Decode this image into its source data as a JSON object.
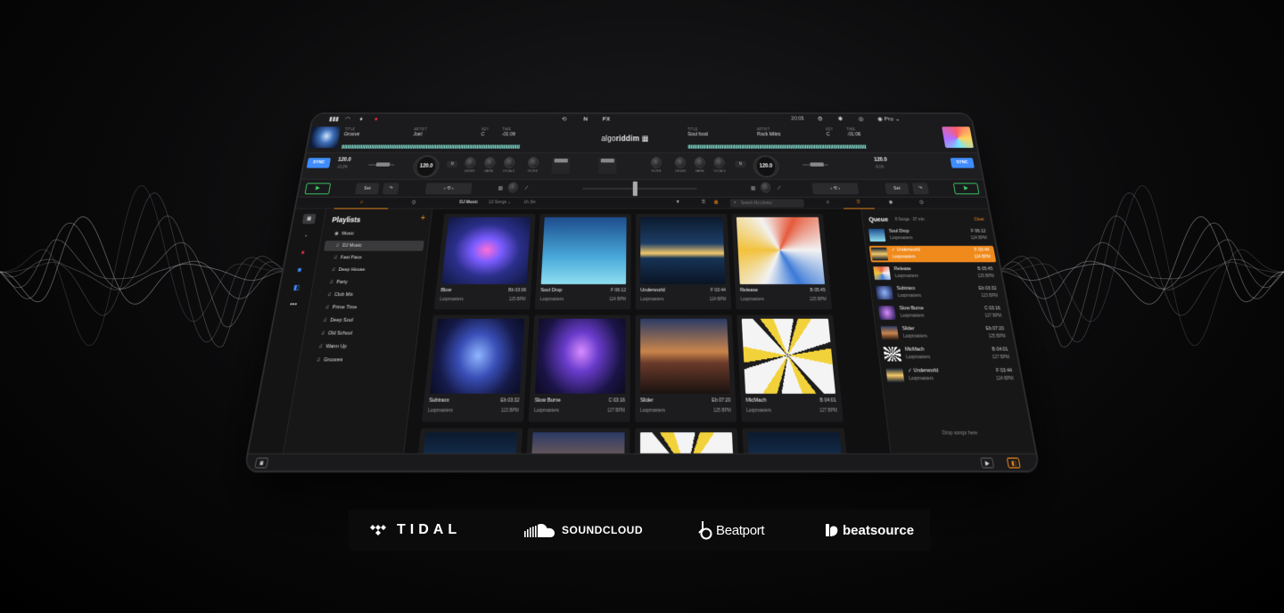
{
  "colors": {
    "accent": "#f08a1c",
    "sync": "#3f8cff",
    "play": "#3ed66a",
    "record": "#e0343a"
  },
  "toolbar": {
    "left_icons": [
      "eq-icon",
      "headphones-icon",
      "mic-icon",
      "record-icon"
    ],
    "center_icons": [
      "loop-icon",
      "n-icon",
      "fx-icon"
    ],
    "center_labels": {
      "n": "N",
      "fx": "FX"
    },
    "clock": "20:05",
    "pro_label": "Pro"
  },
  "deck_left": {
    "title_label": "TITLE",
    "title": "Groove",
    "artist_label": "ARTIST",
    "artist": "Joel",
    "key_label": "KEY",
    "key": "C",
    "time_label": "TIME",
    "time": "-01:09",
    "sync": "SYNC",
    "bpm": "120.0",
    "bpm_sub": "-13.2%",
    "jog_bpm": "120.0",
    "knobs": [
      "DRUMS",
      "HARM.",
      "VOCALS",
      "FILTER"
    ],
    "play": "▶",
    "set": "Set"
  },
  "deck_right": {
    "title_label": "TITLE",
    "title": "Soul food",
    "artist_label": "ARTIST",
    "artist": "Rock Miles",
    "key_label": "KEY",
    "key": "C",
    "time_label": "TIME",
    "time": "-01:06",
    "sync": "SYNC",
    "bpm": "120.0",
    "bpm_sub": "-9.1%",
    "jog_bpm": "120.0",
    "knobs": [
      "FILTER",
      "DRUMS",
      "HARM.",
      "VOCALS"
    ],
    "play": "▶",
    "set": "Set"
  },
  "logo": {
    "brand_light": "algo",
    "brand_bold": "riddim"
  },
  "browse": {
    "section": "DJ Music",
    "song_count": "13 Songs",
    "duration": "1h 3m",
    "search_placeholder": "Search My Library"
  },
  "sidebar": {
    "title": "Playlists",
    "add": "+",
    "items": [
      {
        "label": "Music"
      },
      {
        "label": "DJ Music"
      },
      {
        "label": "Fast Pace"
      },
      {
        "label": "Deep House"
      },
      {
        "label": "Party"
      },
      {
        "label": "Club Mix"
      },
      {
        "label": "Prime Time"
      },
      {
        "label": "Deep Soul"
      },
      {
        "label": "Old School"
      },
      {
        "label": "Warm Up"
      },
      {
        "label": "Grooves"
      }
    ]
  },
  "tracks": [
    {
      "title": "Blow",
      "artist": "Loopmasters",
      "time": "Bb 03:06",
      "bpm": "125 BPM"
    },
    {
      "title": "Soul Drop",
      "artist": "Loopmasters",
      "time": "F 06:12",
      "bpm": "124 BPM"
    },
    {
      "title": "Underworld",
      "artist": "Loopmasters",
      "time": "F 03:44",
      "bpm": "124 BPM"
    },
    {
      "title": "Release",
      "artist": "Loopmasters",
      "time": "B 05:45",
      "bpm": "125 BPM"
    },
    {
      "title": "Subtraxx",
      "artist": "Loopmasters",
      "time": "Eb 03:32",
      "bpm": "123 BPM"
    },
    {
      "title": "Slow Burne",
      "artist": "Loopmasters",
      "time": "C 03:16",
      "bpm": "127 BPM"
    },
    {
      "title": "Slider",
      "artist": "Loopmasters",
      "time": "Eb 07:20",
      "bpm": "125 BPM"
    },
    {
      "title": "MicMach",
      "artist": "Loopmasters",
      "time": "B 04:01",
      "bpm": "127 BPM"
    }
  ],
  "queue": {
    "title": "Queue",
    "info": "8 Songs · 37 min",
    "clear": "Clear",
    "items": [
      {
        "title": "Soul Drop",
        "artist": "Loopmasters",
        "key": "F 06:12",
        "bpm": "124 BPM"
      },
      {
        "title": "Underworld",
        "artist": "Loopmasters",
        "key": "F 03:44",
        "bpm": "124 BPM"
      },
      {
        "title": "Release",
        "artist": "Loopmasters",
        "key": "B 05:45",
        "bpm": "125 BPM"
      },
      {
        "title": "Subtraxx",
        "artist": "Loopmasters",
        "key": "Eb 03:32",
        "bpm": "123 BPM"
      },
      {
        "title": "Slow Burne",
        "artist": "Loopmasters",
        "key": "C 03:16",
        "bpm": "127 BPM"
      },
      {
        "title": "Slider",
        "artist": "Loopmasters",
        "key": "Eb 07:20",
        "bpm": "125 BPM"
      },
      {
        "title": "MicMach",
        "artist": "Loopmasters",
        "key": "B 04:01",
        "bpm": "127 BPM"
      },
      {
        "title": "Underworld",
        "artist": "Loopmasters",
        "key": "F 03:44",
        "bpm": "124 BPM"
      }
    ],
    "drop": "Drop songs here"
  },
  "partners": {
    "tidal": "TIDAL",
    "soundcloud": "SOUNDCLOUD",
    "beatport": "Beatport",
    "beatsource": "beatsource"
  }
}
